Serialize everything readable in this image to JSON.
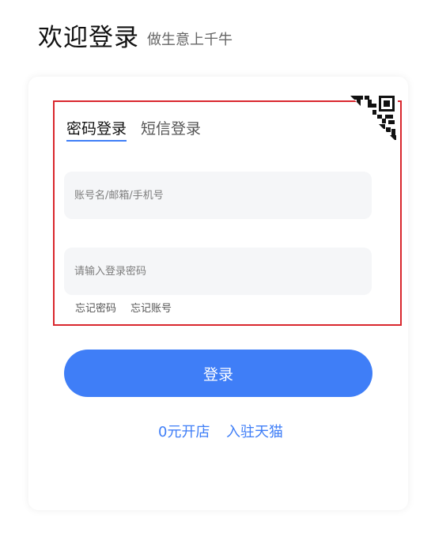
{
  "header": {
    "title": "欢迎登录",
    "subtitle": "做生意上千牛"
  },
  "tabs": [
    {
      "label": "密码登录",
      "active": true
    },
    {
      "label": "短信登录",
      "active": false
    }
  ],
  "form": {
    "account_placeholder": "账号名/邮箱/手机号",
    "password_placeholder": "请输入登录密码",
    "forgot_password": "忘记密码",
    "forgot_account": "忘记账号",
    "login_label": "登录"
  },
  "footer": {
    "open_shop": "0元开店",
    "join_tmall": "入驻天猫"
  },
  "icons": {
    "qr_toggle": "qr-code-icon"
  },
  "colors": {
    "accent": "#3f7ef7",
    "highlight": "#d9272e",
    "input_bg": "#f5f6f8"
  }
}
